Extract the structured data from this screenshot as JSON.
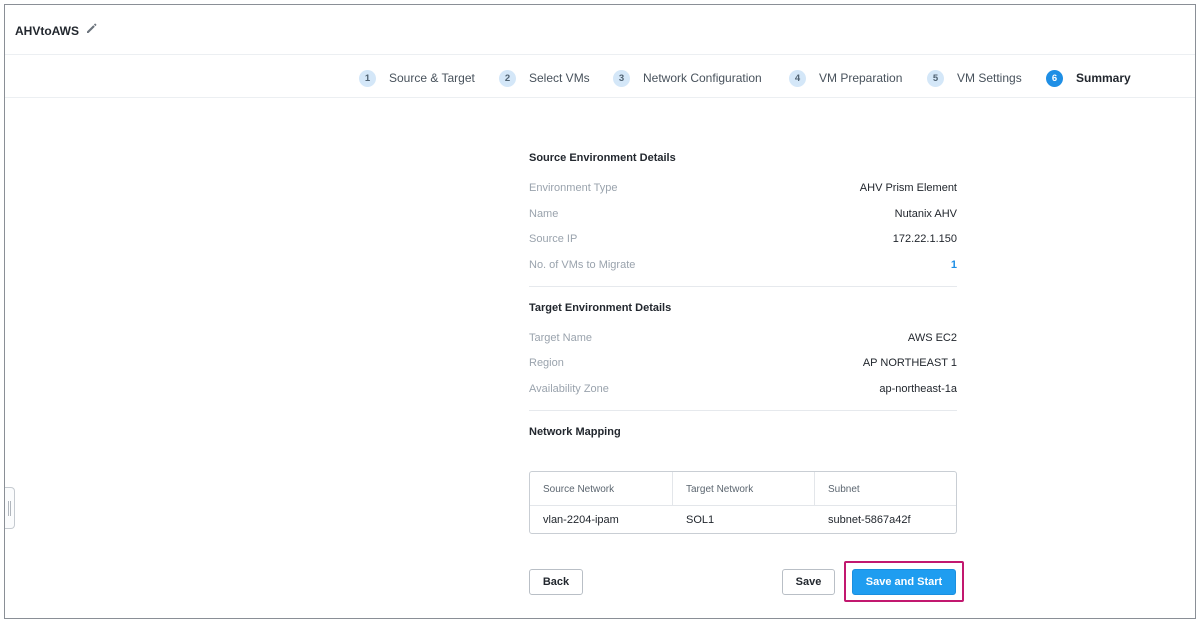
{
  "header": {
    "title": "AHVtoAWS",
    "edit_icon": "pencil-icon"
  },
  "steps": [
    {
      "num": "1",
      "label": "Source & Target"
    },
    {
      "num": "2",
      "label": "Select VMs"
    },
    {
      "num": "3",
      "label": "Network Configuration"
    },
    {
      "num": "4",
      "label": "VM Preparation"
    },
    {
      "num": "5",
      "label": "VM Settings"
    },
    {
      "num": "6",
      "label": "Summary",
      "active": true
    }
  ],
  "source": {
    "title": "Source Environment Details",
    "rows": [
      {
        "key": "Environment Type",
        "value": "AHV Prism Element"
      },
      {
        "key": "Name",
        "value": "Nutanix AHV"
      },
      {
        "key": "Source IP",
        "value": "172.22.1.150"
      },
      {
        "key": "No. of VMs to Migrate",
        "value": "1"
      }
    ]
  },
  "target": {
    "title": "Target Environment Details",
    "rows": [
      {
        "key": "Target Name",
        "value": "AWS EC2"
      },
      {
        "key": "Region",
        "value": "AP NORTHEAST 1"
      },
      {
        "key": "Availability Zone",
        "value": "ap-northeast-1a"
      }
    ]
  },
  "network": {
    "title": "Network Mapping",
    "columns": [
      "Source Network",
      "Target Network",
      "Subnet"
    ],
    "rows": [
      [
        "vlan-2204-ipam",
        "SOL1",
        "subnet-5867a42f"
      ]
    ]
  },
  "buttons": {
    "back": "Back",
    "save": "Save",
    "save_start": "Save and Start"
  },
  "colors": {
    "accent": "#1f8fe5",
    "primary_button": "#1f9df0",
    "highlight": "#c2186f"
  }
}
